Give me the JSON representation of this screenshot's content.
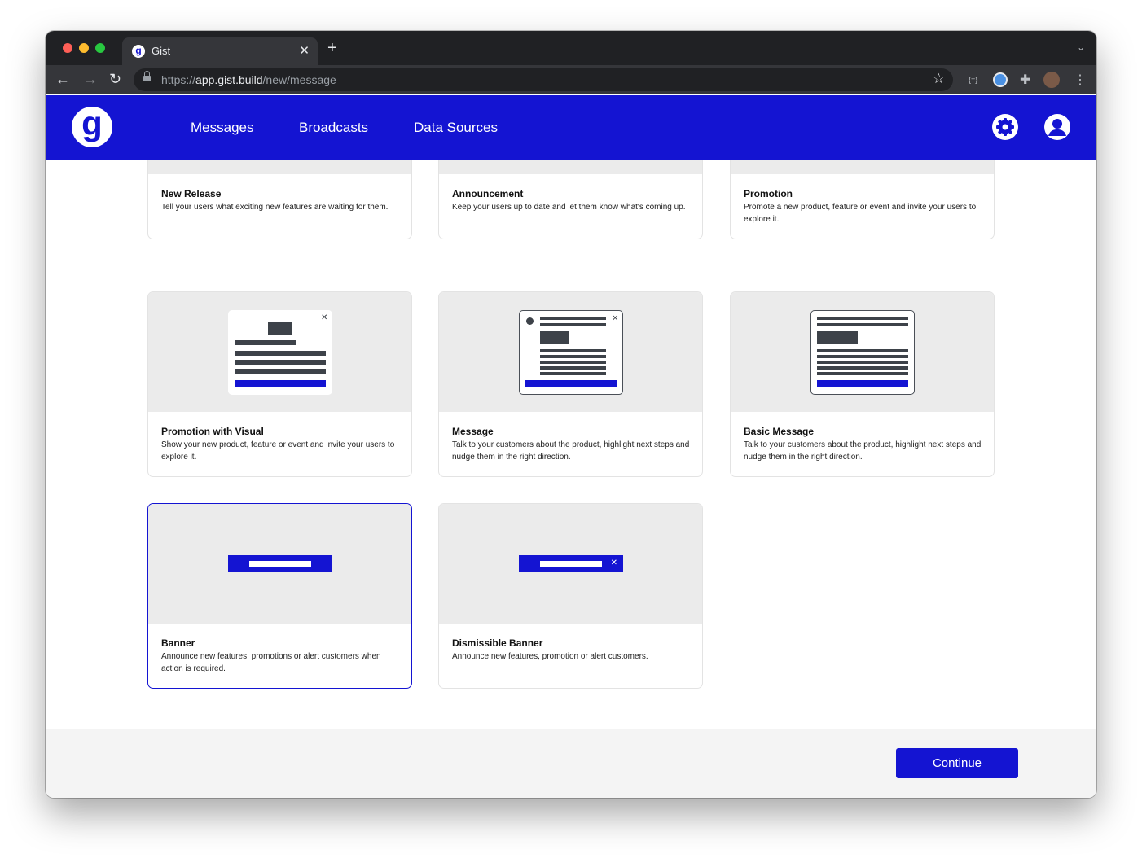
{
  "browser": {
    "tab_title": "Gist",
    "favicon_letter": "g",
    "url_scheme": "https://",
    "url_host": "app.gist.build",
    "url_path": "/new/message",
    "icons": [
      "back-arrow-icon",
      "forward-arrow-icon",
      "reload-icon",
      "lock-icon",
      "star-icon",
      "extensions-icon",
      "menu-icon"
    ]
  },
  "header": {
    "logo_letter": "g",
    "nav": [
      "Messages",
      "Broadcasts",
      "Data Sources"
    ],
    "brand_color": "#1414d2"
  },
  "templates": [
    {
      "title": "New Release",
      "description": "Tell your users what exciting new features are waiting for them.",
      "selected": false
    },
    {
      "title": "Announcement",
      "description": "Keep your users up to date and let them know what's coming up.",
      "selected": false
    },
    {
      "title": "Promotion",
      "description": "Promote a new product, feature or event and invite your users to explore it.",
      "selected": false
    },
    {
      "title": "Promotion with Visual",
      "description": "Show your new product, feature or event and invite your users to explore it.",
      "selected": false
    },
    {
      "title": "Message",
      "description": "Talk to your customers about the product, highlight next steps and nudge them in the right direction.",
      "selected": false
    },
    {
      "title": "Basic Message",
      "description": "Talk to your customers about the product, highlight next steps and nudge them in the right direction.",
      "selected": false
    },
    {
      "title": "Banner",
      "description": "Announce new features, promotions or alert customers when action is required.",
      "selected": true
    },
    {
      "title": "Dismissible Banner",
      "description": "Announce new features, promotion or alert customers.",
      "selected": false
    }
  ],
  "footer": {
    "continue_label": "Continue"
  }
}
